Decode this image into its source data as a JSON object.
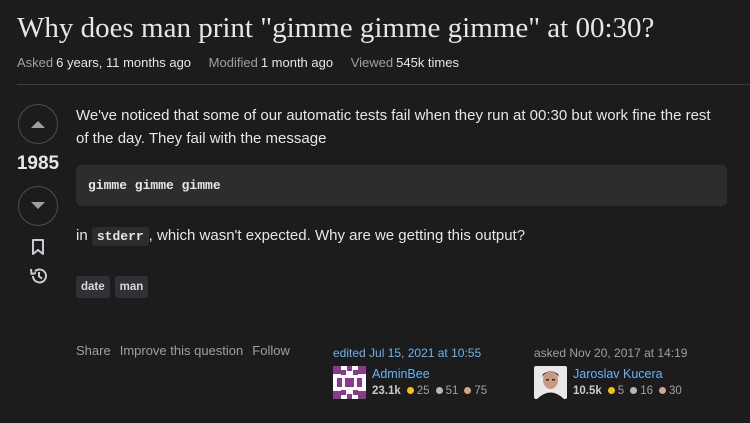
{
  "question": {
    "title": "Why does man print \"gimme gimme gimme\" at 00:30?",
    "meta": {
      "asked_label": "Asked",
      "asked_value": "6 years, 11 months ago",
      "modified_label": "Modified",
      "modified_value": "1 month ago",
      "viewed_label": "Viewed",
      "viewed_value": "545k times"
    },
    "score": "1985",
    "body_text": "We've noticed that some of our automatic tests fail when they run at 00:30 but work fine the rest of the day. They fail with the message",
    "code_block": "gimme gimme gimme",
    "line2_prefix": "in",
    "line2_code": "stderr",
    "line2_suffix": ", which wasn't expected. Why are we getting this output?",
    "tags": [
      "date",
      "man"
    ],
    "actions": [
      "Share",
      "Improve this question",
      "Follow"
    ],
    "edited": {
      "label": "edited Jul 15, 2021 at 10:55",
      "user": "AdminBee",
      "rep": "23.1k",
      "gold": "25",
      "silver": "51",
      "bronze": "75"
    },
    "asked_card": {
      "label": "asked Nov 20, 2017 at 14:19",
      "user": "Jaroslav Kucera",
      "rep": "10.5k",
      "gold": "5",
      "silver": "16",
      "bronze": "30"
    }
  },
  "colors": {
    "gold": "#f1c40f",
    "silver": "#b4b8bc",
    "bronze": "#d1a684",
    "link": "#6bb3f1",
    "background": "#1c1c1d"
  },
  "icons": [
    "upvote-icon",
    "downvote-icon",
    "bookmark-icon",
    "history-icon"
  ]
}
